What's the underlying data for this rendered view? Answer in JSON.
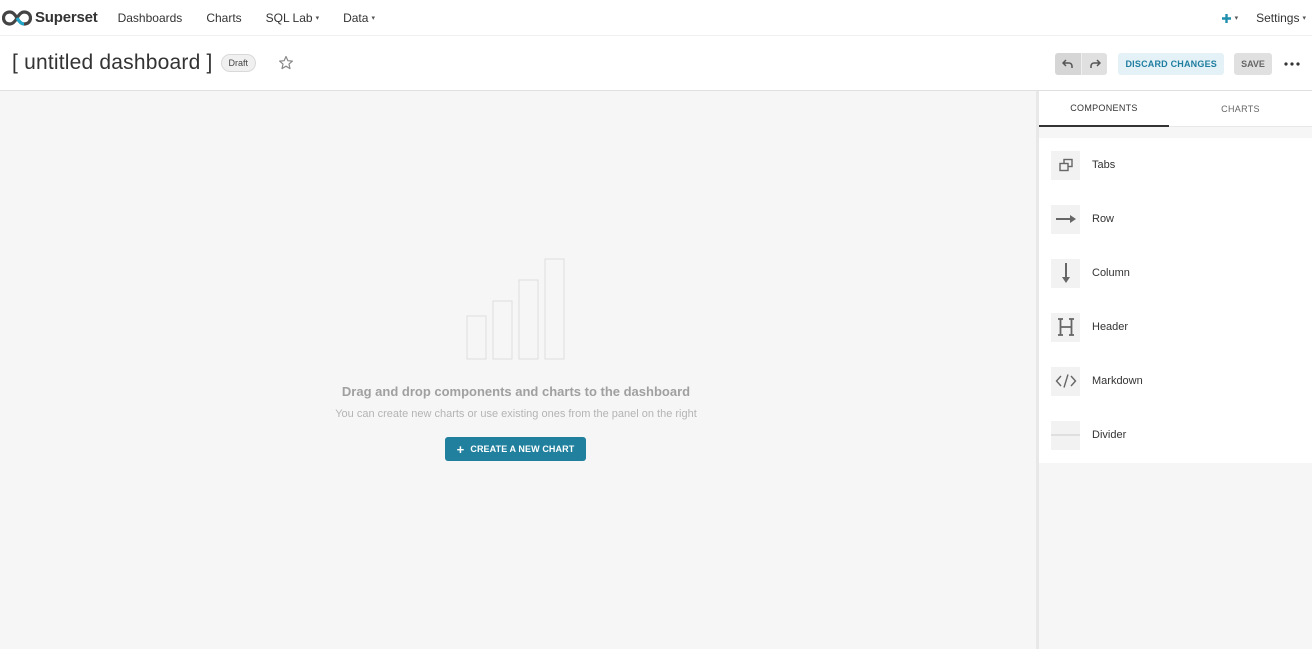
{
  "nav": {
    "brand": "Superset",
    "items": [
      {
        "label": "Dashboards",
        "dropdown": false
      },
      {
        "label": "Charts",
        "dropdown": false
      },
      {
        "label": "SQL Lab",
        "dropdown": true
      },
      {
        "label": "Data",
        "dropdown": true
      }
    ],
    "plus_icon": "plus-icon",
    "settings_label": "Settings",
    "caret": "▾"
  },
  "header": {
    "title": "[ untitled dashboard ]",
    "badge": "Draft",
    "discard_label": "DISCARD CHANGES",
    "save_label": "SAVE"
  },
  "canvas": {
    "empty_title": "Drag and drop components and charts to the dashboard",
    "empty_subtitle": "You can create new charts or use existing ones from the panel on the right",
    "create_button": "CREATE A NEW CHART",
    "create_plus": "+"
  },
  "side": {
    "tabs": [
      {
        "label": "COMPONENTS",
        "active": true
      },
      {
        "label": "CHARTS",
        "active": false
      }
    ],
    "components": [
      {
        "label": "Tabs",
        "icon": "tabs-icon"
      },
      {
        "label": "Row",
        "icon": "row-arrow-icon"
      },
      {
        "label": "Column",
        "icon": "column-arrow-icon"
      },
      {
        "label": "Header",
        "icon": "header-h-icon"
      },
      {
        "label": "Markdown",
        "icon": "code-icon"
      },
      {
        "label": "Divider",
        "icon": "divider-icon"
      }
    ]
  },
  "colors": {
    "accent": "#20809e",
    "discard_bg": "#e4f1f6",
    "canvas_bg": "#f6f6f6"
  }
}
